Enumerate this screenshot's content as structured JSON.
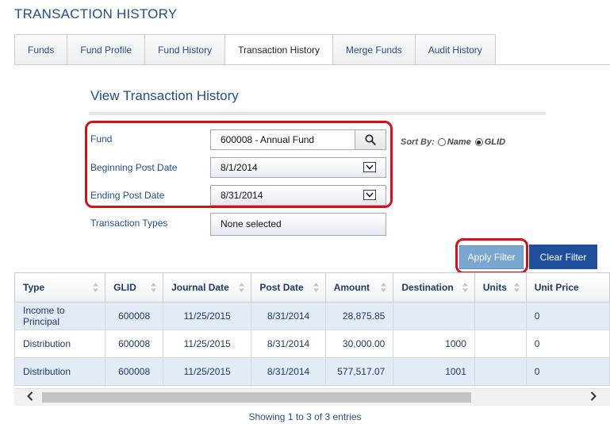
{
  "page_title": "TRANSACTION HISTORY",
  "tabs": [
    {
      "label": "Funds"
    },
    {
      "label": "Fund Profile"
    },
    {
      "label": "Fund History"
    },
    {
      "label": "Transaction History"
    },
    {
      "label": "Merge Funds"
    },
    {
      "label": "Audit History"
    }
  ],
  "section_title": "View Transaction History",
  "form": {
    "fund_label": "Fund",
    "fund_value": "600008 - Annual Fund",
    "begin_label": "Beginning Post Date",
    "begin_value": "8/1/2014",
    "end_label": "Ending Post Date",
    "end_value": "8/31/2014",
    "types_label": "Transaction Types",
    "types_value": "None selected"
  },
  "sort_by": {
    "label": "Sort By:",
    "option_name": "Name",
    "option_glid": "GLID",
    "selected": "GLID"
  },
  "buttons": {
    "apply": "Apply Filter",
    "clear": "Clear Filter"
  },
  "table": {
    "columns": [
      "Type",
      "GLID",
      "Journal Date",
      "Post Date",
      "Amount",
      "Destination",
      "Units",
      "Unit Price"
    ],
    "rows": [
      [
        "Income to Principal",
        "600008",
        "11/25/2015",
        "8/31/2014",
        "28,875.85",
        "",
        "",
        "0"
      ],
      [
        "Distribution",
        "600008",
        "11/25/2015",
        "8/31/2014",
        "30,000.00",
        "1000",
        "",
        "0"
      ],
      [
        "Distribution",
        "600008",
        "11/25/2015",
        "8/31/2014",
        "577,517.07",
        "1001",
        "",
        "0"
      ]
    ]
  },
  "footer": "Showing 1 to 3 of 3 entries",
  "colors": {
    "brand_blue": "#1f4e8c",
    "highlight_red": "#d0121d",
    "clear_button": "#1e4f9a",
    "apply_button": "#7aa6cf",
    "alt_row": "#e3ebf6"
  },
  "icons": {
    "search": "search-icon",
    "dropdown": "chevron-down-icon",
    "scroll_left": "chevron-left-icon",
    "scroll_right": "chevron-right-icon"
  }
}
